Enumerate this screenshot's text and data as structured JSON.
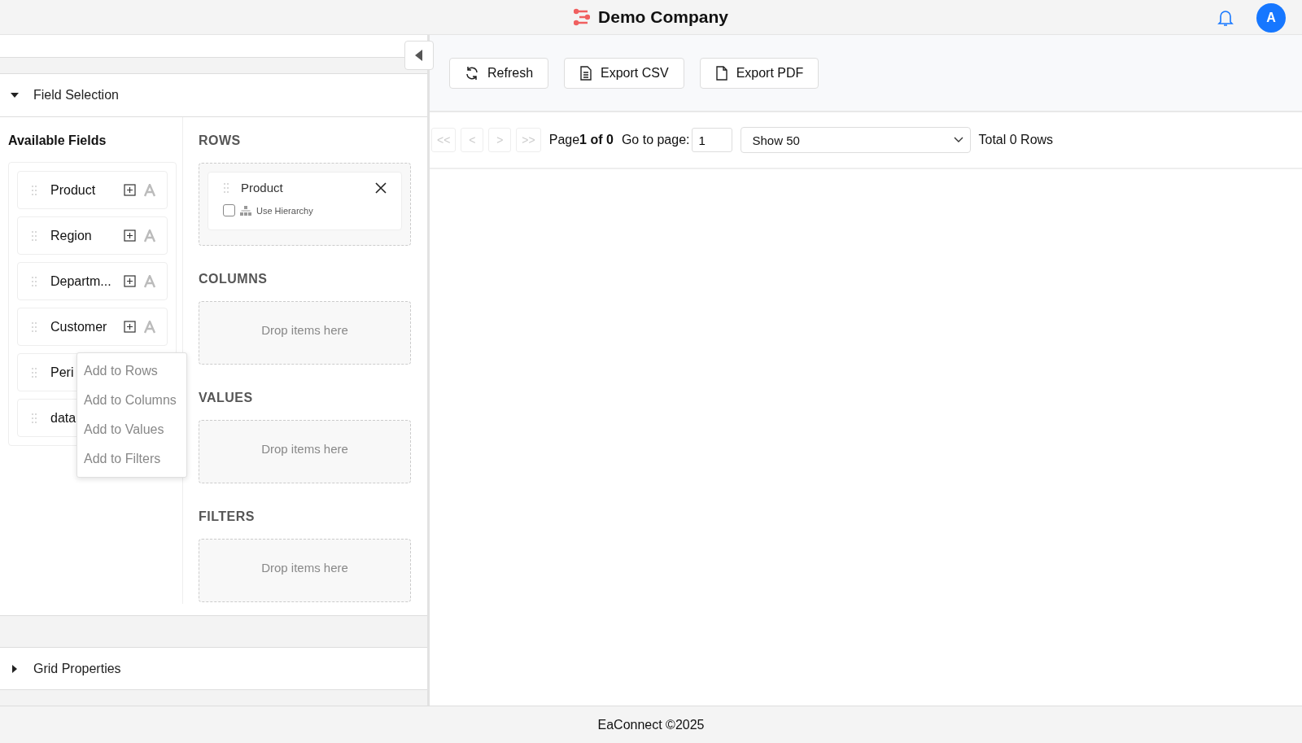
{
  "header": {
    "title": "Demo Company",
    "avatar": "A"
  },
  "field_selection": {
    "title": "Field Selection",
    "expanded": true,
    "available_title": "Available Fields",
    "fields": [
      {
        "name": "Product"
      },
      {
        "name": "Region"
      },
      {
        "name": "Departm..."
      },
      {
        "name": "Customer"
      },
      {
        "name": "Peri"
      },
      {
        "name": "data"
      }
    ],
    "context_menu": [
      "Add to Rows",
      "Add to Columns",
      "Add to Values",
      "Add to Filters"
    ],
    "zones": [
      {
        "title": "ROWS",
        "items": [
          {
            "name": "Product",
            "option": "Use Hierarchy",
            "checked": false
          }
        ]
      },
      {
        "title": "COLUMNS",
        "placeholder": "Drop items here"
      },
      {
        "title": "VALUES",
        "placeholder": "Drop items here"
      },
      {
        "title": "FILTERS",
        "placeholder": "Drop items here"
      }
    ]
  },
  "grid_properties": {
    "title": "Grid Properties",
    "expanded": false
  },
  "toolbar": [
    {
      "label": "Refresh",
      "kind": "refresh"
    },
    {
      "label": "Export CSV",
      "kind": "csv"
    },
    {
      "label": "Export PDF",
      "kind": "pdf"
    }
  ],
  "pager": {
    "buttons": [
      {
        "label": "<<",
        "disabled": true
      },
      {
        "label": "<",
        "disabled": true
      },
      {
        "label": ">",
        "disabled": true
      },
      {
        "label": ">>",
        "disabled": true
      }
    ],
    "page_text": "Page**1 of 0**",
    "goto_label": "Go to page:",
    "goto_value": "1",
    "page_size": "Show 50",
    "total": "Total 0 Rows"
  },
  "footer": "EaConnect ©2025"
}
